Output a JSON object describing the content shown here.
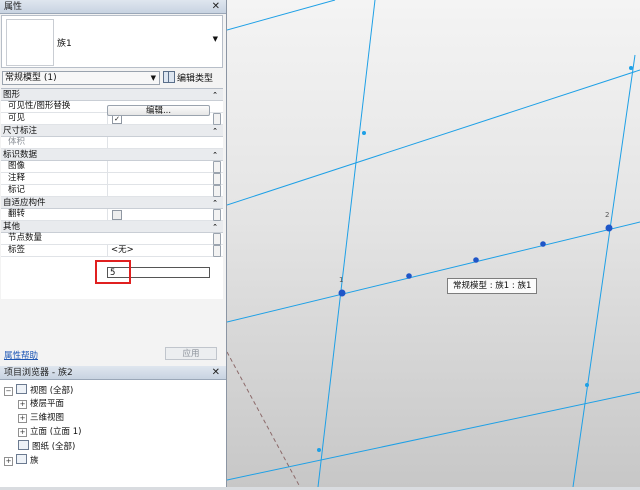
{
  "properties_panel": {
    "title": "属性",
    "close": "✕",
    "type_name": "族1",
    "category_select": "常规模型 (1)",
    "edit_type": "编辑类型",
    "groups": [
      {
        "label": "图形",
        "chevron": "⌃"
      },
      {
        "label": "尺寸标注",
        "chevron": "⌃"
      },
      {
        "label": "标识数据",
        "chevron": "⌃"
      },
      {
        "label": "自适应构件",
        "chevron": "⌃"
      },
      {
        "label": "其他",
        "chevron": "⌃"
      }
    ],
    "rows": {
      "visibility_override": {
        "label": "可见性/图形替换",
        "button": "编辑..."
      },
      "visible": {
        "label": "可见",
        "checked": true,
        "check_glyph": "✓"
      },
      "volume": {
        "label": "体积"
      },
      "image": {
        "label": "图像"
      },
      "comments": {
        "label": "注释"
      },
      "mark": {
        "label": "标记"
      },
      "flip": {
        "label": "翻转",
        "checked": false
      },
      "node_count": {
        "label": "节点数量",
        "value": "5"
      },
      "tag": {
        "label": "标签",
        "value": "<无>"
      }
    },
    "help_link": "属性帮助",
    "apply_button": "应用"
  },
  "project_browser": {
    "title": "项目浏览器 - 族2",
    "close": "✕",
    "tree": [
      {
        "label": "视图 (全部)",
        "toggle": "⊟",
        "level": 0
      },
      {
        "label": "楼层平面",
        "toggle": "⊞",
        "level": 1
      },
      {
        "label": "三维视图",
        "toggle": "⊞",
        "level": 1
      },
      {
        "label": "立面 (立面 1)",
        "toggle": "⊞",
        "level": 1
      },
      {
        "label": "图纸 (全部)",
        "toggle": "",
        "level": 0
      },
      {
        "label": "族",
        "toggle": "⊞",
        "level": 0
      }
    ]
  },
  "canvas": {
    "tooltip": "常规模型 : 族1 : 族1",
    "point_labels": [
      "1",
      "2"
    ],
    "line_color": "#1ea0e6",
    "point_color": "#1f56c8"
  }
}
